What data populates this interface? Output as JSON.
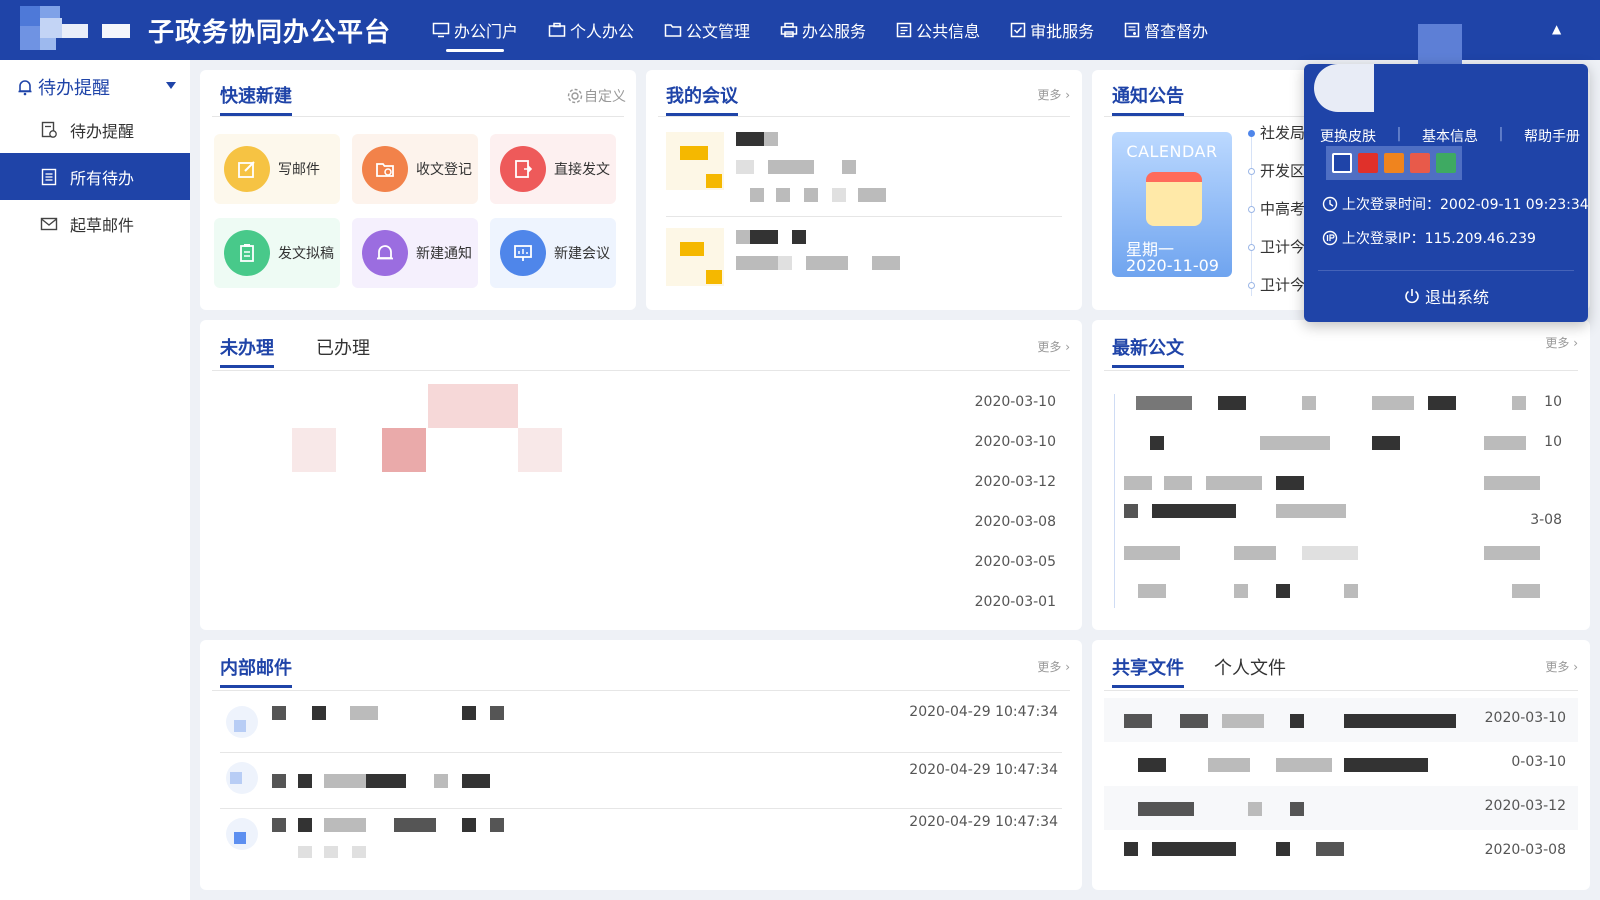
{
  "header": {
    "title": "子政务协同办公平台",
    "nav": [
      {
        "label": "办公门户",
        "icon": "monitor-icon"
      },
      {
        "label": "个人办公",
        "icon": "briefcase-icon"
      },
      {
        "label": "公文管理",
        "icon": "folder-icon"
      },
      {
        "label": "办公服务",
        "icon": "printer-icon"
      },
      {
        "label": "公共信息",
        "icon": "info-icon"
      },
      {
        "label": "审批服务",
        "icon": "approval-icon"
      },
      {
        "label": "督查督办",
        "icon": "supervise-icon"
      }
    ]
  },
  "sidebar": {
    "header": "待办提醒",
    "items": [
      {
        "label": "待办提醒",
        "icon": "reminder-icon"
      },
      {
        "label": "所有待办",
        "icon": "list-icon"
      },
      {
        "label": "起草邮件",
        "icon": "mail-icon"
      }
    ]
  },
  "quick_create": {
    "title": "快速新建",
    "customize": "自定义",
    "items": [
      {
        "label": "写邮件",
        "color": "#f6c343"
      },
      {
        "label": "收文登记",
        "color": "#f2824a"
      },
      {
        "label": "直接发文",
        "color": "#ee5a5a"
      },
      {
        "label": "发文拟稿",
        "color": "#48c98a"
      },
      {
        "label": "新建通知",
        "color": "#9b6de0"
      },
      {
        "label": "新建会议",
        "color": "#4f86ea"
      }
    ]
  },
  "meetings": {
    "title": "我的会议",
    "more": "更多"
  },
  "notices": {
    "title": "通知公告",
    "calendar_label": "CALENDAR",
    "weekday": "星期一",
    "date": "2020-11-09",
    "items": [
      "社发局",
      "开发区",
      "中高考",
      "卫计今",
      "卫计今"
    ]
  },
  "todo": {
    "tabs": [
      "未办理",
      "已办理"
    ],
    "more": "更多",
    "dates": [
      "2020-03-10",
      "2020-03-10",
      "2020-03-12",
      "2020-03-08",
      "2020-03-05",
      "2020-03-01"
    ]
  },
  "latest_docs": {
    "title": "最新公文",
    "more": "更多",
    "date_fragments": [
      "10",
      "10",
      "",
      "3-08",
      "",
      ""
    ]
  },
  "mail": {
    "title": "内部邮件",
    "more": "更多",
    "times": [
      "2020-04-29 10:47:34",
      "2020-04-29 10:47:34",
      "2020-04-29 10:47:34"
    ]
  },
  "files": {
    "tabs": [
      "共享文件",
      "个人文件"
    ],
    "more": "更多",
    "dates": [
      "2020-03-10",
      "0-03-10",
      "2020-03-12",
      "2020-03-08"
    ]
  },
  "user_popover": {
    "links": [
      "更换皮肤",
      "基本信息",
      "帮助手册"
    ],
    "skins": [
      "#1f44a8",
      "#e0302a",
      "#f0841e",
      "#e85a4a",
      "#3eaa62"
    ],
    "last_login_time": "上次登录时间：2002-09-11 09:23:34",
    "last_login_ip": "上次登录IP：115.209.46.239",
    "logout": "退出系统"
  }
}
